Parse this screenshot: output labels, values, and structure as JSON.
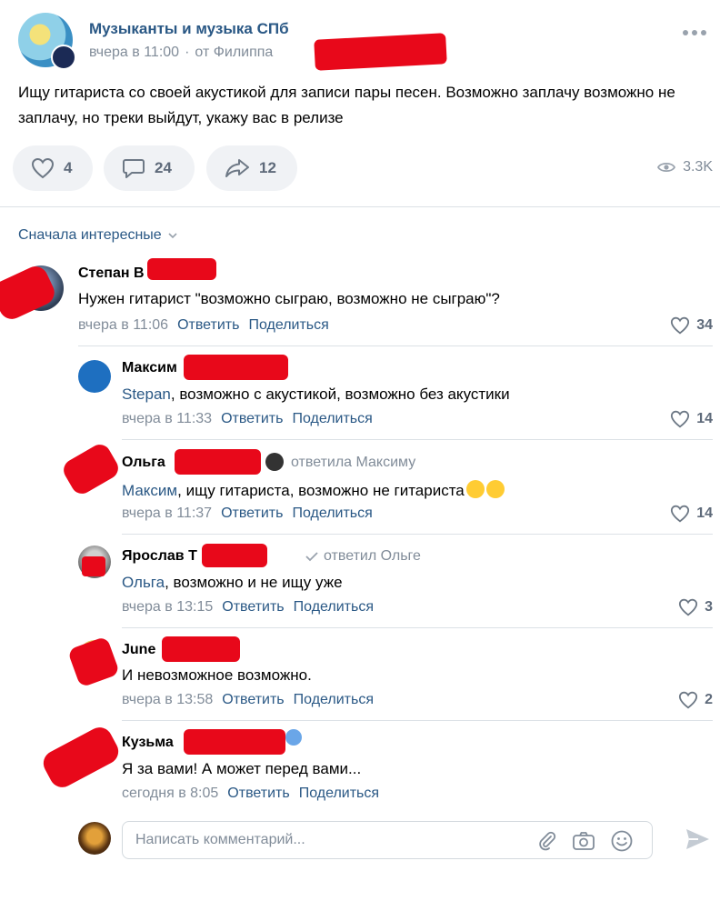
{
  "post": {
    "group_name": "Музыканты и музыка СПб",
    "time": "вчера в 11:00",
    "from": "от Филиппа",
    "text": "Ищу гитариста со своей акустикой для записи пары песен. Возможно заплачу возможно не заплачу, но треки выйдут, укажу вас в релизе",
    "likes": "4",
    "comments": "24",
    "shares": "12",
    "views": "3.3K"
  },
  "sort_label": "Сначала интересные",
  "labels": {
    "reply": "Ответить",
    "share": "Поделиться"
  },
  "comments": [
    {
      "author": "Степан В",
      "text": "Нужен гитарист \"возможно сыграю, возможно не сыграю\"?",
      "time": "вчера в 11:06",
      "likes": "34"
    },
    {
      "author": "Максим",
      "mention": "Stepan",
      "text": ", возможно с акустикой, возможно без акустики",
      "time": "вчера в 11:33",
      "likes": "14"
    },
    {
      "author": "Ольга",
      "reply_to": "ответила Максиму",
      "mention": "Максим",
      "text": ", ищу гитариста, возможно не гитариста",
      "time": "вчера в 11:37",
      "likes": "14"
    },
    {
      "author": "Ярослав Т",
      "reply_to": "ответил Ольге",
      "mention": "Ольга",
      "text": ", возможно и не ищу уже",
      "time": "вчера в 13:15",
      "likes": "3"
    },
    {
      "author": "June",
      "text": "И невозможное возможно.",
      "time": "вчера в 13:58",
      "likes": "2"
    },
    {
      "author": "Кузьма",
      "text": "Я за вами! А может перед вами...",
      "time": "сегодня в 8:05",
      "likes": ""
    }
  ],
  "composer": {
    "placeholder": "Написать комментарий..."
  },
  "colors": {
    "link": "#2a5885",
    "muted": "#818c99",
    "pill_bg": "#f0f2f5",
    "redaction": "#e8081a"
  }
}
